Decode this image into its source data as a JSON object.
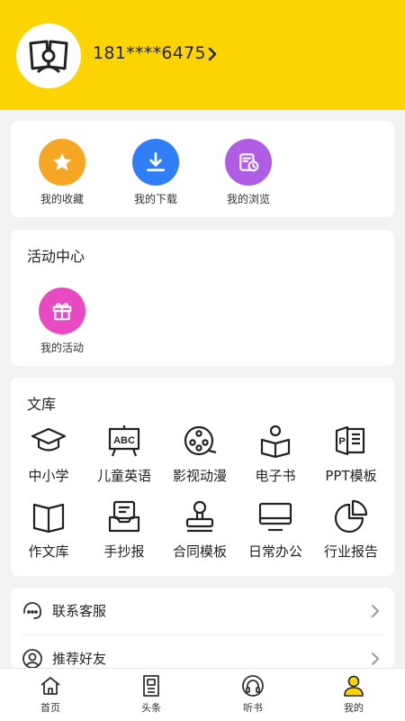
{
  "profile": {
    "phone": "181****6475"
  },
  "quick_actions": [
    {
      "label": "我的收藏",
      "icon": "star-icon",
      "color": "#f5a623"
    },
    {
      "label": "我的下载",
      "icon": "download-icon",
      "color": "#2f7ef5"
    },
    {
      "label": "我的浏览",
      "icon": "history-icon",
      "color": "#b05de6"
    }
  ],
  "activity": {
    "title": "活动中心",
    "items": [
      {
        "label": "我的活动",
        "icon": "gift-icon",
        "color": "#e84ac1"
      }
    ]
  },
  "library": {
    "title": "文库",
    "items": [
      {
        "label": "中小学",
        "icon": "graduation-cap-icon"
      },
      {
        "label": "儿童英语",
        "icon": "abc-board-icon"
      },
      {
        "label": "影视动漫",
        "icon": "film-reel-icon"
      },
      {
        "label": "电子书",
        "icon": "reader-book-icon"
      },
      {
        "label": "PPT模板",
        "icon": "ppt-file-icon"
      },
      {
        "label": "作文库",
        "icon": "open-book-icon"
      },
      {
        "label": "手抄报",
        "icon": "handcopy-icon"
      },
      {
        "label": "合同模板",
        "icon": "stamp-icon"
      },
      {
        "label": "日常办公",
        "icon": "monitor-icon"
      },
      {
        "label": "行业报告",
        "icon": "pie-chart-icon"
      }
    ]
  },
  "menu": [
    {
      "label": "联系客服",
      "icon": "headset-icon"
    },
    {
      "label": "推荐好友",
      "icon": "user-icon"
    }
  ],
  "tabbar": {
    "active_color": "#fcd404",
    "tabs": [
      {
        "label": "首页",
        "icon": "home-icon"
      },
      {
        "label": "头条",
        "icon": "news-icon"
      },
      {
        "label": "听书",
        "icon": "headphones-icon"
      },
      {
        "label": "我的",
        "icon": "profile-icon"
      }
    ]
  }
}
